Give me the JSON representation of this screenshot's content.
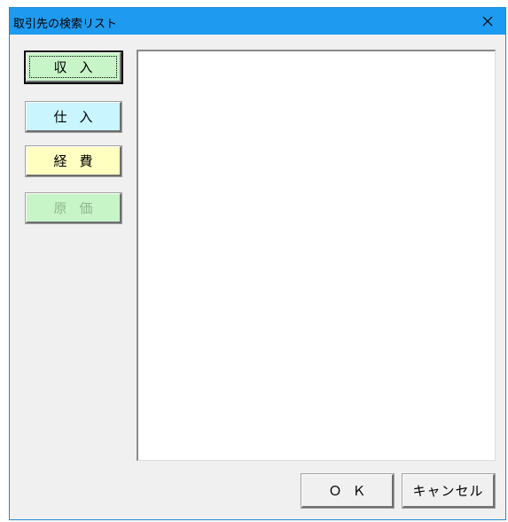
{
  "window": {
    "title": "取引先の検索リスト"
  },
  "category_buttons": [
    {
      "label": "収入",
      "color": "#c8f5c8",
      "state": "selected"
    },
    {
      "label": "仕入",
      "color": "#c8f5ff",
      "state": "normal"
    },
    {
      "label": "経費",
      "color": "#ffffc0",
      "state": "normal"
    },
    {
      "label": "原価",
      "color": "#c8f5c8",
      "state": "disabled"
    }
  ],
  "listbox": {
    "items": []
  },
  "footer": {
    "ok_label": "ＯＫ",
    "cancel_label": "キャンセル"
  },
  "colors": {
    "titlebar": "#1e9bf0",
    "dialog_background": "#f0f0f0"
  },
  "icons": {
    "close": "close-icon"
  }
}
